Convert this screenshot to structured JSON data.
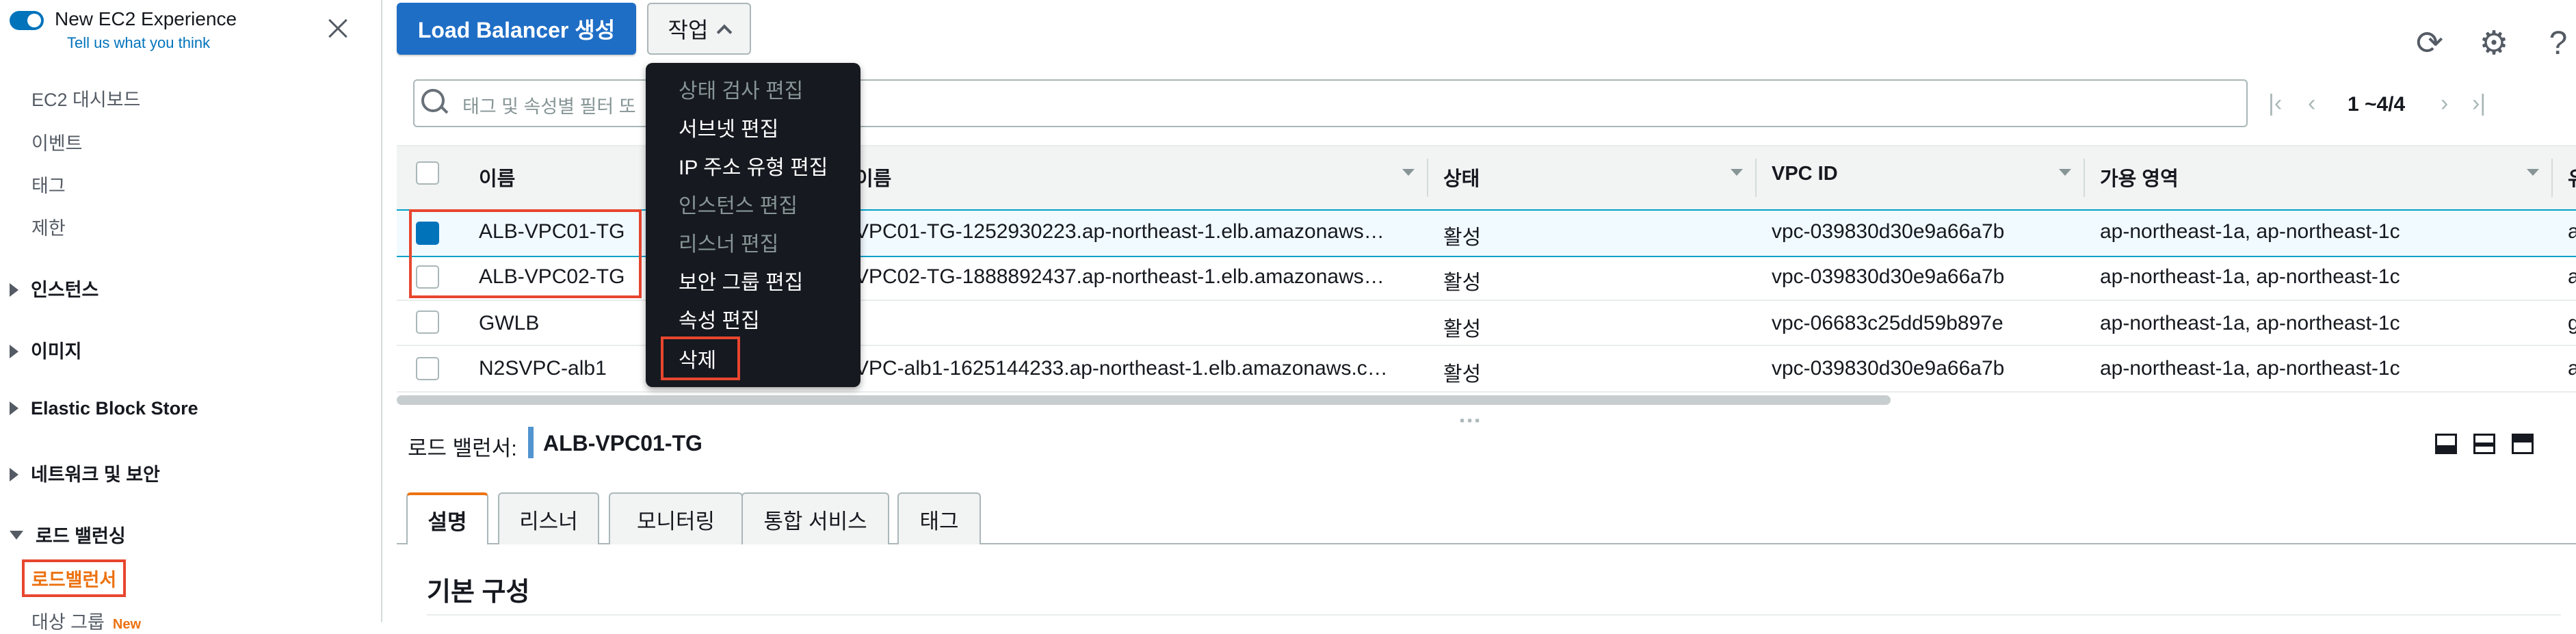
{
  "sidebar": {
    "title": "New EC2 Experience",
    "subtitle": "Tell us what you think",
    "items": [
      "EC2 대시보드",
      "이벤트",
      "태그",
      "제한"
    ],
    "groups": [
      "인스턴스",
      "이미지",
      "Elastic Block Store",
      "네트워크 및 보안",
      "로드 밸런싱"
    ],
    "active_item": "로드밸런서",
    "target_item": "대상 그룹",
    "new_badge": "New"
  },
  "toolbar": {
    "create_label": "Load Balancer 생성",
    "actions_label": "작업",
    "icons": [
      "refresh-icon",
      "gear-icon",
      "help-icon"
    ]
  },
  "search": {
    "placeholder": "태그 및 속성별 필터 또"
  },
  "pager": {
    "text": "1 ~4/4"
  },
  "actions_menu": {
    "items": [
      {
        "label": "상태 검사 편집",
        "disabled": true
      },
      {
        "label": "서브넷 편집",
        "disabled": false
      },
      {
        "label": "IP 주소 유형 편집",
        "disabled": false
      },
      {
        "label": "인스턴스 편집",
        "disabled": true
      },
      {
        "label": "리스너 편집",
        "disabled": true
      },
      {
        "label": "보안 그룹 편집",
        "disabled": false
      },
      {
        "label": "속성 편집",
        "disabled": false
      },
      {
        "label": "삭제",
        "disabled": false
      }
    ]
  },
  "table": {
    "columns": [
      "이름",
      "이름",
      "상태",
      "VPC ID",
      "가용 영역",
      "유"
    ],
    "rows": [
      {
        "name": "ALB-VPC01-TG",
        "dns": "VPC01-TG-1252930223.ap-northeast-1.elb.amazonaws…",
        "state": "활성",
        "vpc": "vpc-039830d30e9a66a7b",
        "az": "ap-northeast-1a, ap-northeast-1c",
        "type": "a",
        "selected": true
      },
      {
        "name": "ALB-VPC02-TG",
        "dns": "VPC02-TG-1888892437.ap-northeast-1.elb.amazonaws…",
        "state": "활성",
        "vpc": "vpc-039830d30e9a66a7b",
        "az": "ap-northeast-1a, ap-northeast-1c",
        "type": "a",
        "selected": false
      },
      {
        "name": "GWLB",
        "dns": "",
        "state": "활성",
        "vpc": "vpc-06683c25dd59b897e",
        "az": "ap-northeast-1a, ap-northeast-1c",
        "type": "g",
        "selected": false
      },
      {
        "name": "N2SVPC-alb1",
        "dns": "VPC-alb1-1625144233.ap-northeast-1.elb.amazonaws.c…",
        "state": "활성",
        "vpc": "vpc-039830d30e9a66a7b",
        "az": "ap-northeast-1a, ap-northeast-1c",
        "type": "a",
        "selected": false
      }
    ]
  },
  "details": {
    "label": "로드 밸런서:",
    "value": "ALB-VPC01-TG",
    "tabs": [
      "설명",
      "리스너",
      "모니터링",
      "통합 서비스",
      "태그"
    ],
    "section_title": "기본 구성"
  }
}
